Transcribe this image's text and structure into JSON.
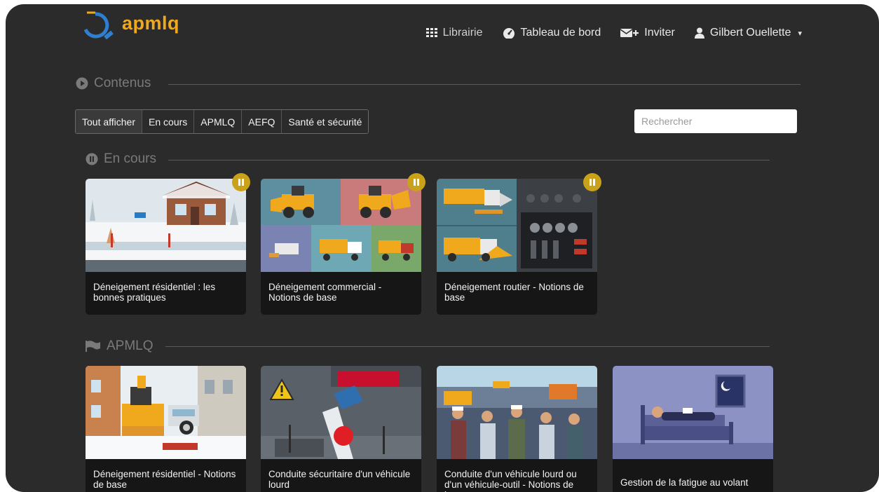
{
  "brand": {
    "name": "apmlq"
  },
  "nav": {
    "library": "Librairie",
    "dashboard": "Tableau de bord",
    "invite": "Inviter",
    "user": "Gilbert Ouellette"
  },
  "sections": {
    "contents": "Contenus",
    "in_progress": "En cours",
    "apmlq": "APMLQ"
  },
  "filters": [
    "Tout afficher",
    "En cours",
    "APMLQ",
    "AEFQ",
    "Santé et sécurité"
  ],
  "search": {
    "placeholder": "Rechercher"
  },
  "in_progress_cards": [
    {
      "title": "Déneigement résidentiel : les bonnes pratiques"
    },
    {
      "title": "Déneigement commercial - Notions de base"
    },
    {
      "title": "Déneigement routier - Notions de base"
    }
  ],
  "apmlq_cards": [
    {
      "title": "Déneigement résidentiel - Notions de base"
    },
    {
      "title": "Conduite sécuritaire d'un véhicule lourd"
    },
    {
      "title": "Conduite d'un véhicule lourd ou d'un véhicule-outil - Notions de base"
    },
    {
      "title": "Gestion de la fatigue au volant"
    }
  ],
  "colors": {
    "background": "#2b2b2b",
    "brand": "#f0a81c",
    "badge": "#c9a21a",
    "card": "#161616"
  }
}
